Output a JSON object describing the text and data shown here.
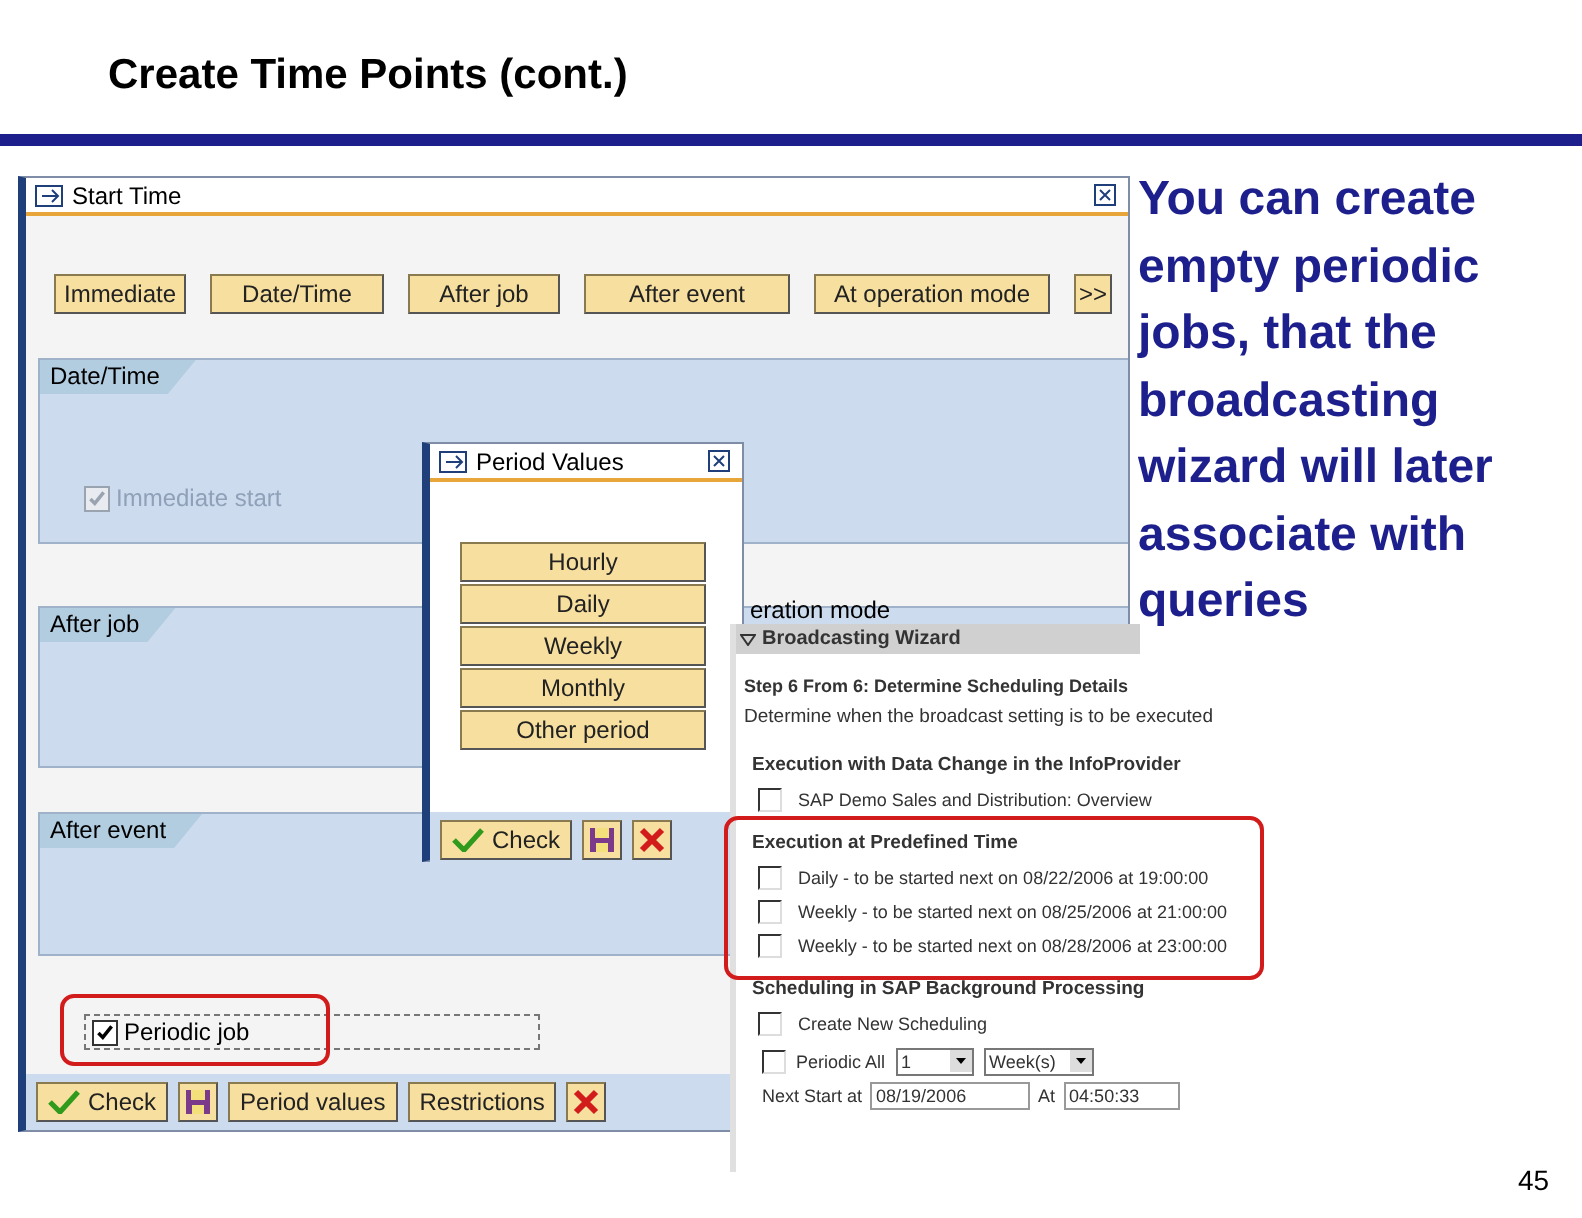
{
  "slide": {
    "title": "Create Time Points (cont.)",
    "body": "You can create empty periodic jobs, that the broadcasting wizard will later associate with queries",
    "page_number": "45"
  },
  "start_time_window": {
    "title": "Start Time",
    "buttons": [
      "Immediate",
      "Date/Time",
      "After job",
      "After event",
      "At operation mode",
      ">>"
    ],
    "groups": [
      {
        "label": "Date/Time",
        "checkbox": {
          "label": "Immediate start",
          "checked": true,
          "disabled": true
        }
      },
      {
        "label": "After job"
      },
      {
        "label": "After event"
      }
    ],
    "partial_label": "eration mode",
    "periodic_job": {
      "label": "Periodic job",
      "checked": true,
      "highlighted": true
    },
    "toolbar": [
      {
        "kind": "check",
        "label": "Check"
      },
      {
        "kind": "save"
      },
      {
        "kind": "text",
        "label": "Period values"
      },
      {
        "kind": "text",
        "label": "Restrictions"
      },
      {
        "kind": "cancel"
      }
    ]
  },
  "period_values_window": {
    "title": "Period Values",
    "buttons": [
      "Hourly",
      "Daily",
      "Weekly",
      "Monthly",
      "Other period"
    ],
    "toolbar": [
      {
        "kind": "check",
        "label": "Check"
      },
      {
        "kind": "save"
      },
      {
        "kind": "cancel"
      }
    ]
  },
  "broadcasting_wizard": {
    "title": "Broadcasting Wizard",
    "step": "Step 6 From 6: Determine Scheduling Details",
    "description": "Determine when the broadcast setting is to be executed",
    "sections": [
      {
        "heading": "Execution with Data Change in the InfoProvider",
        "highlighted": false,
        "items": [
          {
            "label": "SAP Demo Sales and Distribution: Overview",
            "checked": false
          }
        ]
      },
      {
        "heading": "Execution at Predefined Time",
        "highlighted": true,
        "items": [
          {
            "label": "Daily - to be started next on 08/22/2006 at 19:00:00",
            "checked": false
          },
          {
            "label": "Weekly - to be started next on 08/25/2006 at 21:00:00",
            "checked": false
          },
          {
            "label": "Weekly - to be started next on 08/28/2006 at 23:00:00",
            "checked": false
          }
        ]
      },
      {
        "heading": "Scheduling in SAP Background Processing",
        "highlighted": false,
        "items": [
          {
            "label": "Create New Scheduling",
            "checked": false
          }
        ]
      }
    ],
    "periodic": {
      "label": "Periodic All",
      "checked": false,
      "count": "1",
      "unit": "Week(s)"
    },
    "next_start": {
      "label": "Next Start at",
      "date": "08/19/2006",
      "at_label": "At",
      "time": "04:50:33"
    }
  }
}
